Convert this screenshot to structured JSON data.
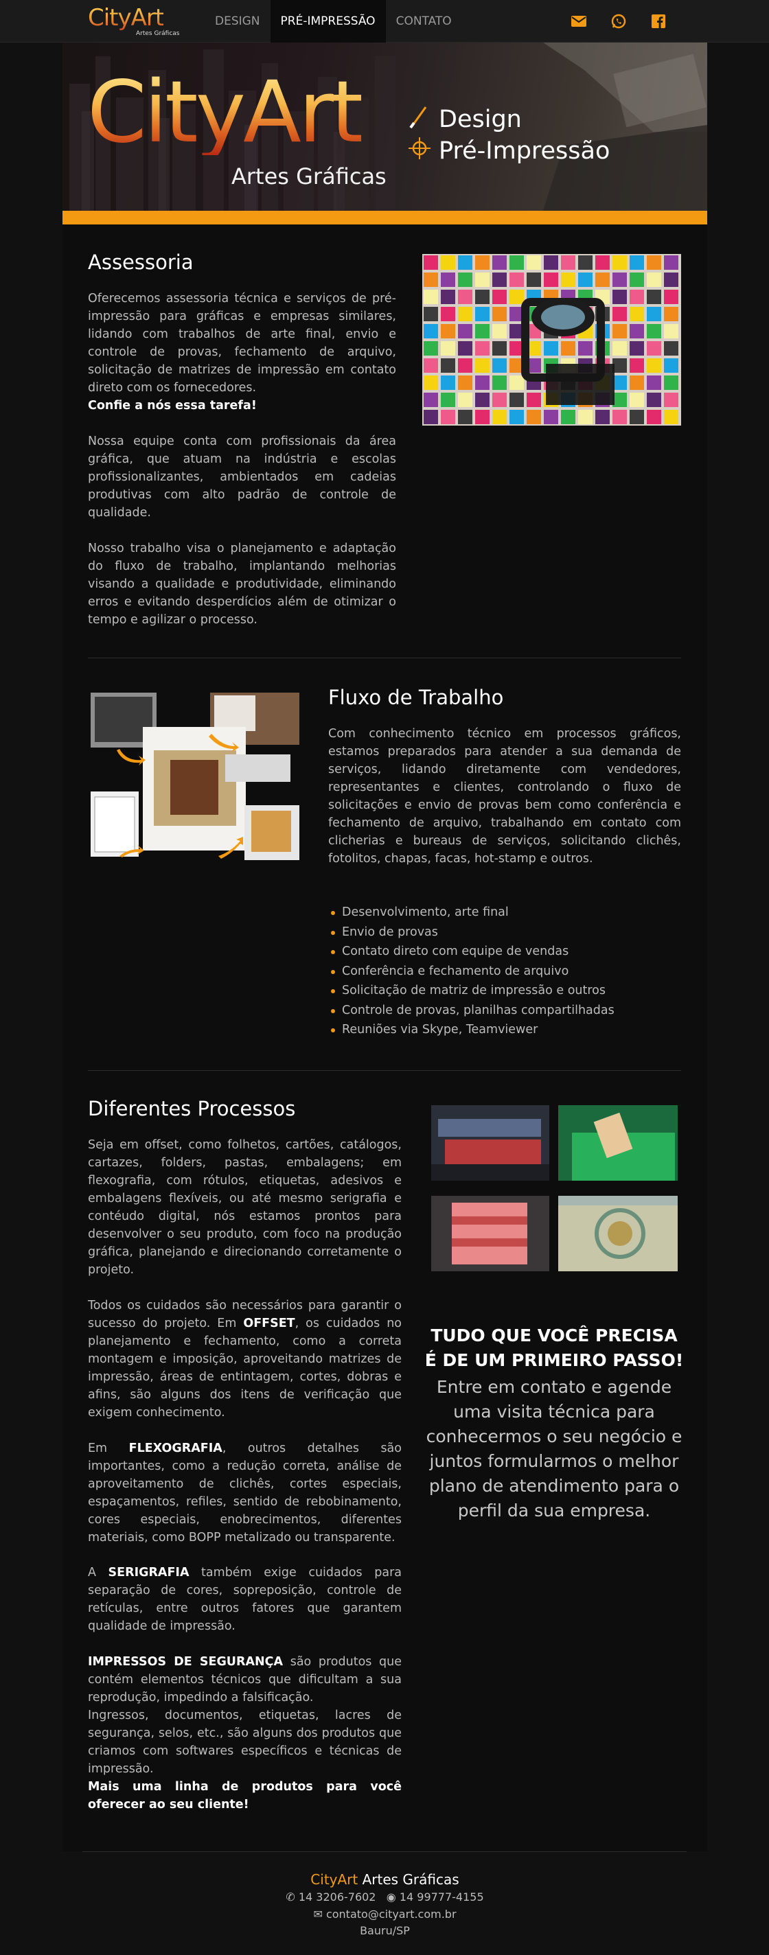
{
  "navbar": {
    "logo_main": "CityArt",
    "logo_sub": "Artes Gráficas",
    "items": [
      {
        "label": "DESIGN",
        "active": false
      },
      {
        "label": "PRÉ-IMPRESSÃO",
        "active": true
      },
      {
        "label": "CONTATO",
        "active": false
      }
    ],
    "icons": [
      "envelope-icon",
      "whatsapp-icon",
      "facebook-icon"
    ],
    "accent_color": "#f39a12"
  },
  "hero": {
    "logo_main": "CityArt",
    "logo_sub": "Artes Gráficas",
    "tags": [
      "Design",
      "Pré-Impressão"
    ],
    "tag_icons": [
      "brush-icon",
      "crosshair-icon"
    ]
  },
  "assessoria": {
    "title": "Assessoria",
    "p1": "Oferecemos assessoria técnica e serviços de pré-impressão para gráficas e empresas similares, lidando com trabalhos de arte final, envio e controle de provas, fechamento de arquivo, solicitação de matrizes de impressão em contato direto com os fornecedores.",
    "highlight": "Confie a nós essa tarefa!",
    "p2": "Nossa equipe conta com profissionais da área gráfica, que atuam na indústria e escolas profissionalizantes, ambientados em cadeias produtivas com alto padrão de controle de qualidade.",
    "p3": "Nosso trabalho visa o planejamento e adaptação do fluxo de trabalho, implantando melhorias visando a qualidade e produtividade, eliminando erros e evitando desperdícios além de otimizar o tempo e agilizar o processo."
  },
  "fluxo": {
    "title": "Fluxo de Trabalho",
    "p1": "Com conhecimento técnico em processos gráficos, estamos preparados para atender a sua demanda de serviços, lidando diretamente com vendedores, representantes e clientes, controlando o fluxo de solicitações e envio de provas bem como conferência e fechamento de arquivo, trabalhando em contato com clicherias e bureaus de serviços, solicitando clichês, fotolitos, chapas, facas, hot-stamp e outros.",
    "bullets": [
      "Desenvolvimento, arte final",
      "Envio de provas",
      "Contato direto com equipe de vendas",
      "Conferência e fechamento de arquivo",
      "Solicitação de matriz de impressão e outros",
      "Controle de provas, planilhas compartilhadas",
      "Reuniões via Skype, Teamviewer"
    ]
  },
  "processos": {
    "title": "Diferentes Processos",
    "p1": "Seja em offset, como folhetos, cartões, catálogos, cartazes, folders, pastas, embalagens; em flexografia, com rótulos, etiquetas, adesivos e embalagens flexíveis, ou até mesmo serigrafia e contéudo digital, nós estamos prontos para desenvolver o seu produto, com foco na produção gráfica, planejando e direcionando corretamente o projeto.",
    "p2_a": "Todos os cuidados são necessários para garantir o sucesso do projeto. Em ",
    "p2_bold": "OFFSET",
    "p2_b": ", os cuidados no planejamento e fechamento, como a correta montagem e imposição, aproveitando matrizes de impressão, áreas de entintagem, cortes, dobras e afins, são alguns dos itens de verificação que exigem conhecimento.",
    "p3_a": "Em ",
    "p3_bold": "FLEXOGRAFIA",
    "p3_b": ", outros detalhes são importantes, como a redução correta, análise de aproveitamento de clichês, cortes especiais, espaçamentos, refiles, sentido de rebobinamento, cores especiais, enobrecimentos, diferentes materiais, como BOPP metalizado ou transparente.",
    "p4_a": "A ",
    "p4_bold": "SERIGRAFIA",
    "p4_b": " também exige cuidados para separação de cores, sopreposição, controle de retículas, entre outros fatores que garantem qualidade de impressão.",
    "p5_bold": "IMPRESSOS DE SEGURANÇA",
    "p5_b": " são produtos que contém elementos técnicos que dificultam a sua reprodução, impedindo a falsificação.",
    "p6": "Ingressos, documentos, etiquetas, lacres de segurança, selos, etc., são alguns dos produtos que criamos com softwares específicos e técnicas de impressão.",
    "highlight": "Mais uma linha de produtos para você oferecer ao seu cliente!",
    "cta_title": "TUDO QUE VOCÊ PRECISA É DE UM PRIMEIRO PASSO!",
    "cta_text": "Entre em contato e agende uma visita técnica para conhecermos o seu negócio e juntos formularmos o melhor plano de atendimento para o perfil da sua empresa."
  },
  "footer": {
    "brand_accent": "CityArt",
    "brand_rest": " Artes Gráficas",
    "phone": "14 3206-7602",
    "whatsapp": "14 99777-4155",
    "email": "contato@cityart.com.br",
    "city": "Bauru/SP"
  }
}
